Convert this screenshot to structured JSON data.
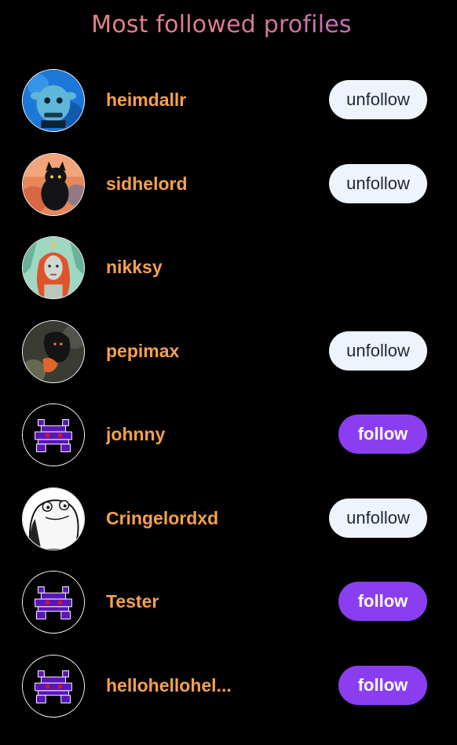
{
  "header": {
    "title": "Most followed profiles"
  },
  "colors": {
    "username": "#f6a04d",
    "follow_button": "#8b3ef0",
    "unfollow_button": "#eef4fb",
    "background": "#000000"
  },
  "profiles": [
    {
      "username": "heimdallr",
      "action": "unfollow",
      "avatar_icon": "blue-troll-avatar-icon"
    },
    {
      "username": "sidhelord",
      "action": "unfollow",
      "avatar_icon": "black-cat-avatar-icon"
    },
    {
      "username": "nikksy",
      "action": "",
      "avatar_icon": "red-hair-portrait-avatar-icon"
    },
    {
      "username": "pepimax",
      "action": "unfollow",
      "avatar_icon": "dark-creature-avatar-icon"
    },
    {
      "username": "johnny",
      "action": "follow",
      "avatar_icon": "pixel-invader-avatar-icon"
    },
    {
      "username": "Cringelordxd",
      "action": "unfollow",
      "avatar_icon": "frog-sketch-avatar-icon"
    },
    {
      "username": "Tester",
      "action": "follow",
      "avatar_icon": "pixel-invader-avatar-icon"
    },
    {
      "username": "hellohellohel...",
      "action": "follow",
      "avatar_icon": "pixel-invader-avatar-icon"
    }
  ]
}
